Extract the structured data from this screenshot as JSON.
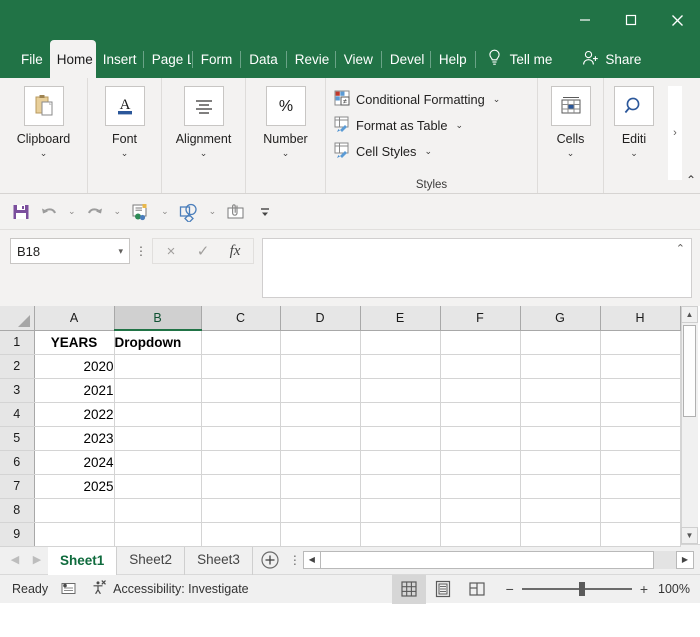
{
  "window": {
    "minimize_label": "Minimize",
    "maximize_label": "Maximize",
    "close_label": "Close",
    "theme_color": "#217346"
  },
  "ribbon_tabs": [
    {
      "label": "File",
      "active": false
    },
    {
      "label": "Home",
      "active": true
    },
    {
      "label": "Insert",
      "active": false
    },
    {
      "label": "Page L",
      "active": false
    },
    {
      "label": "Form",
      "active": false
    },
    {
      "label": "Data",
      "active": false
    },
    {
      "label": "Revie",
      "active": false
    },
    {
      "label": "View",
      "active": false
    },
    {
      "label": "Devel",
      "active": false
    },
    {
      "label": "Help",
      "active": false
    }
  ],
  "tell_me": {
    "label": "Tell me",
    "icon": "lightbulb-icon"
  },
  "share": {
    "label": "Share",
    "icon": "person-add-icon"
  },
  "ribbon_groups": [
    {
      "label": "Clipboard",
      "icon": "clipboard-icon",
      "chevron": "⌄"
    },
    {
      "label": "Font",
      "icon": "font-a-icon",
      "chevron": "⌄"
    },
    {
      "label": "Alignment",
      "icon": "alignment-icon",
      "chevron": "⌄"
    },
    {
      "label": "Number",
      "icon": "percent-icon",
      "chevron": "⌄"
    }
  ],
  "styles_group": {
    "name": "Styles",
    "items": [
      {
        "label": "Conditional Formatting",
        "icon": "conditional-formatting-icon",
        "chevron": "⌄"
      },
      {
        "label": "Format as Table",
        "icon": "format-as-table-icon",
        "chevron": "⌄"
      },
      {
        "label": "Cell Styles",
        "icon": "cell-styles-icon",
        "chevron": "⌄"
      }
    ]
  },
  "cells_group": {
    "label": "Cells",
    "icon": "cells-icon",
    "chevron": "⌄"
  },
  "editing_group": {
    "label": "Editi",
    "icon": "find-magnifier-icon",
    "chevron": "⌄"
  },
  "ribbon_scroll_right": "›",
  "ribbon_collapse": "⌃",
  "quick_access": [
    {
      "name": "save-button",
      "icon": "save-floppy-icon"
    },
    {
      "name": "undo-button",
      "icon": "undo-arrow-icon"
    },
    {
      "name": "redo-button",
      "icon": "redo-arrow-icon"
    },
    {
      "name": "send-to-contacts-button",
      "icon": "send-contact-icon"
    },
    {
      "name": "shapes-button",
      "icon": "shapes-icon"
    },
    {
      "name": "attach-button",
      "icon": "attach-clip-icon"
    },
    {
      "name": "customize-toolbar-button",
      "icon": "customize-overflow-icon"
    }
  ],
  "formula_bar": {
    "name_box_value": "B18",
    "name_box_caret": "▾",
    "cancel_label": "×",
    "enter_label": "✓",
    "function_label": "fx",
    "formula_value": "",
    "expander": "⌃"
  },
  "grid": {
    "columns": [
      "A",
      "B",
      "C",
      "D",
      "E",
      "F",
      "G",
      "H"
    ],
    "active_column": "B",
    "rows": [
      {
        "num": "1",
        "cells": [
          "YEARS",
          "Dropdown",
          "",
          "",
          "",
          "",
          "",
          ""
        ]
      },
      {
        "num": "2",
        "cells": [
          "2020",
          "",
          "",
          "",
          "",
          "",
          "",
          ""
        ]
      },
      {
        "num": "3",
        "cells": [
          "2021",
          "",
          "",
          "",
          "",
          "",
          "",
          ""
        ]
      },
      {
        "num": "4",
        "cells": [
          "2022",
          "",
          "",
          "",
          "",
          "",
          "",
          ""
        ]
      },
      {
        "num": "5",
        "cells": [
          "2023",
          "",
          "",
          "",
          "",
          "",
          "",
          ""
        ]
      },
      {
        "num": "6",
        "cells": [
          "2024",
          "",
          "",
          "",
          "",
          "",
          "",
          ""
        ]
      },
      {
        "num": "7",
        "cells": [
          "2025",
          "",
          "",
          "",
          "",
          "",
          "",
          ""
        ]
      },
      {
        "num": "8",
        "cells": [
          "",
          "",
          "",
          "",
          "",
          "",
          "",
          ""
        ]
      },
      {
        "num": "9",
        "cells": [
          "",
          "",
          "",
          "",
          "",
          "",
          "",
          ""
        ]
      }
    ],
    "scroll_up": "▲",
    "scroll_down": "▼"
  },
  "sheet_tabs": {
    "prev_arrow": "◀",
    "next_arrow": "▶",
    "tabs": [
      {
        "label": "Sheet1",
        "active": true
      },
      {
        "label": "Sheet2",
        "active": false
      },
      {
        "label": "Sheet3",
        "active": false
      }
    ],
    "add_sheet": "+",
    "hscroll_left": "◀",
    "hscroll_right": "▶"
  },
  "status_bar": {
    "mode": "Ready",
    "macro_icon": "record-macro-icon",
    "accessibility_icon": "accessibility-icon",
    "accessibility": "Accessibility: Investigate",
    "views": [
      {
        "name": "normal-view-button",
        "icon": "grid-view-icon",
        "active": true
      },
      {
        "name": "page-layout-view-button",
        "icon": "page-layout-icon",
        "active": false
      },
      {
        "name": "page-break-view-button",
        "icon": "page-break-icon",
        "active": false
      }
    ],
    "zoom_out": "−",
    "zoom_in": "+",
    "zoom_level": "100%"
  }
}
